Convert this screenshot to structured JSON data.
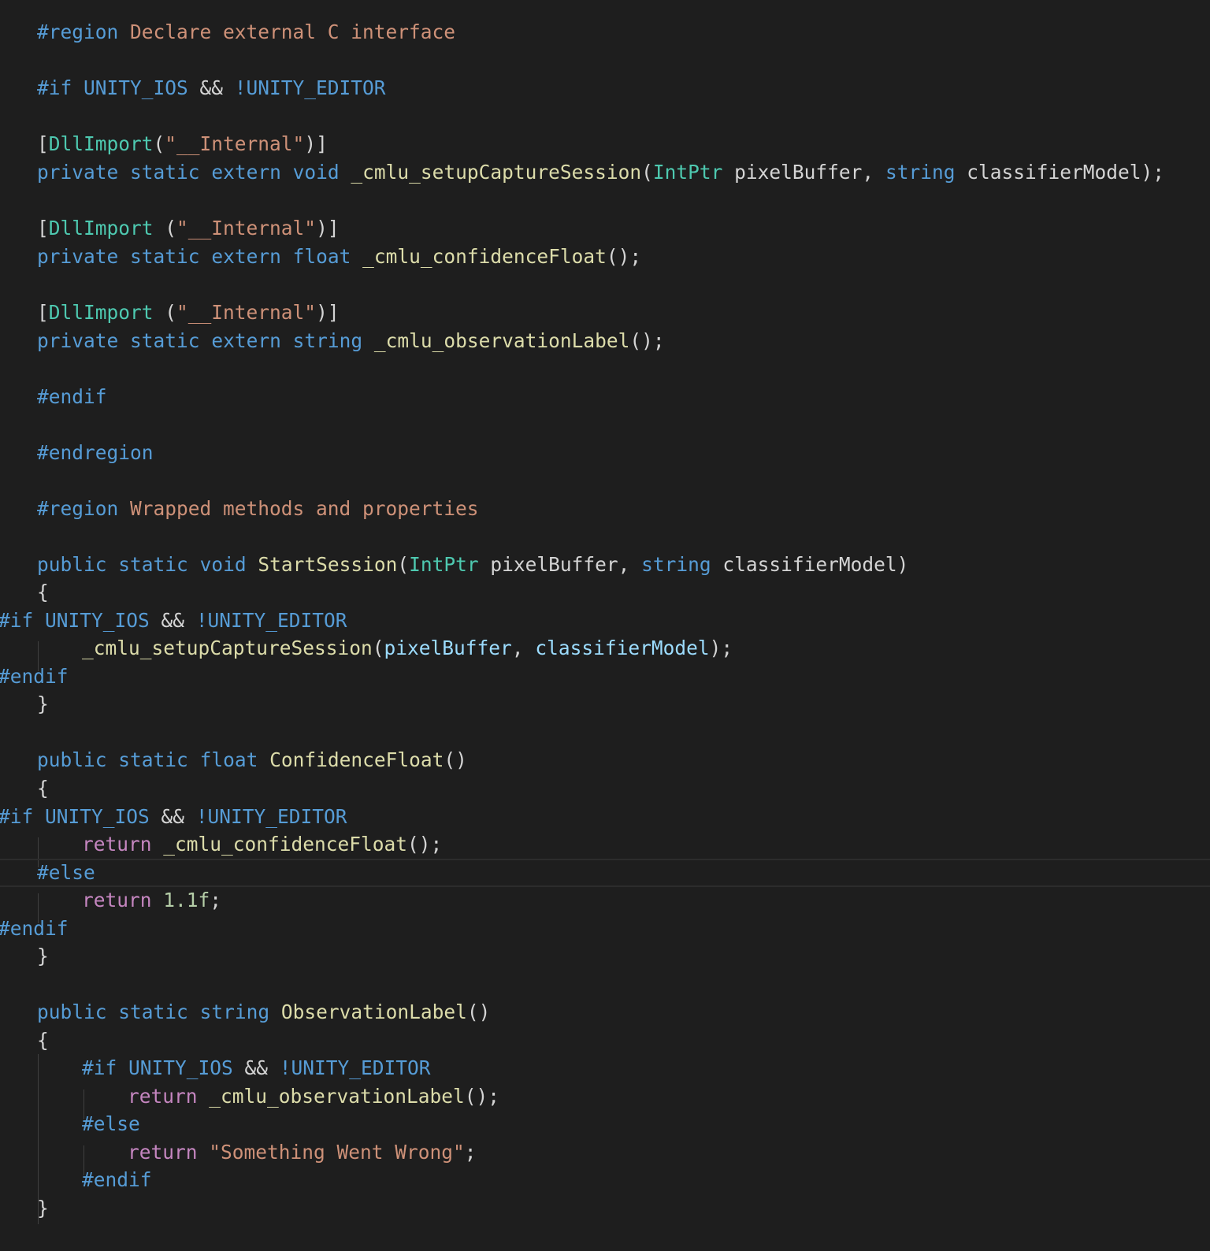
{
  "editor": {
    "theme_colors": {
      "background": "#1e1e1e",
      "keyword": "#569cd6",
      "control": "#c586c0",
      "type": "#4ec9b0",
      "function": "#dcdcaa",
      "variable": "#9cdcfe",
      "string": "#ce9178",
      "number": "#b5cea8",
      "text": "#d4d4d4"
    },
    "lines": [
      {
        "tokens": [
          [
            "pre",
            "#region"
          ],
          [
            "reg",
            " Declare external C interface"
          ]
        ]
      },
      {
        "tokens": [
          [
            "pre",
            "#if UNITY_IOS "
          ],
          [
            "punc",
            "&& "
          ],
          [
            "pre",
            "!UNITY_EDITOR"
          ]
        ]
      },
      {
        "tokens": [
          [
            "punc",
            "["
          ],
          [
            "type",
            "DllImport"
          ],
          [
            "punc",
            "("
          ],
          [
            "str",
            "\"__Internal\""
          ],
          [
            "punc",
            ")]"
          ]
        ]
      },
      {
        "tokens": [
          [
            "kw",
            "private"
          ],
          [
            "punc",
            " "
          ],
          [
            "kw",
            "static"
          ],
          [
            "punc",
            " "
          ],
          [
            "kw",
            "extern"
          ],
          [
            "punc",
            " "
          ],
          [
            "kw",
            "void"
          ],
          [
            "punc",
            " "
          ],
          [
            "fn",
            "_cmlu_setupCaptureSession"
          ],
          [
            "punc",
            "("
          ],
          [
            "type",
            "IntPtr"
          ],
          [
            "id",
            " pixelBuffer, "
          ],
          [
            "kw",
            "string"
          ],
          [
            "id",
            " classifierModel);"
          ]
        ]
      },
      {
        "tokens": [
          [
            "punc",
            "["
          ],
          [
            "type",
            "DllImport"
          ],
          [
            "punc",
            " ("
          ],
          [
            "str",
            "\"__Internal\""
          ],
          [
            "punc",
            ")]"
          ]
        ]
      },
      {
        "tokens": [
          [
            "kw",
            "private"
          ],
          [
            "punc",
            " "
          ],
          [
            "kw",
            "static"
          ],
          [
            "punc",
            " "
          ],
          [
            "kw",
            "extern"
          ],
          [
            "punc",
            " "
          ],
          [
            "kw",
            "float"
          ],
          [
            "punc",
            " "
          ],
          [
            "fn",
            "_cmlu_confidenceFloat"
          ],
          [
            "punc",
            "();"
          ]
        ]
      },
      {
        "tokens": [
          [
            "punc",
            "["
          ],
          [
            "type",
            "DllImport"
          ],
          [
            "punc",
            " ("
          ],
          [
            "str",
            "\"__Internal\""
          ],
          [
            "punc",
            ")]"
          ]
        ]
      },
      {
        "tokens": [
          [
            "kw",
            "private"
          ],
          [
            "punc",
            " "
          ],
          [
            "kw",
            "static"
          ],
          [
            "punc",
            " "
          ],
          [
            "kw",
            "extern"
          ],
          [
            "punc",
            " "
          ],
          [
            "kw",
            "string"
          ],
          [
            "punc",
            " "
          ],
          [
            "fn",
            "_cmlu_observationLabel"
          ],
          [
            "punc",
            "();"
          ]
        ]
      },
      {
        "tokens": [
          [
            "pre",
            "#endif"
          ]
        ]
      },
      {
        "tokens": [
          [
            "pre",
            "#endregion"
          ]
        ]
      },
      {
        "tokens": [
          [
            "pre",
            "#region"
          ],
          [
            "reg",
            " Wrapped methods and properties"
          ]
        ]
      },
      {
        "tokens": [
          [
            "kw",
            "public"
          ],
          [
            "punc",
            " "
          ],
          [
            "kw",
            "static"
          ],
          [
            "punc",
            " "
          ],
          [
            "kw",
            "void"
          ],
          [
            "punc",
            " "
          ],
          [
            "fn",
            "StartSession"
          ],
          [
            "punc",
            "("
          ],
          [
            "type",
            "IntPtr"
          ],
          [
            "id",
            " pixelBuffer, "
          ],
          [
            "kw",
            "string"
          ],
          [
            "id",
            " classifierModel)"
          ]
        ]
      },
      {
        "tokens": [
          [
            "punc",
            "{"
          ]
        ]
      },
      {
        "tokens": [
          [
            "pre",
            "#if UNITY_IOS "
          ],
          [
            "punc",
            "&& "
          ],
          [
            "pre",
            "!UNITY_EDITOR"
          ]
        ]
      },
      {
        "tokens": [
          [
            "fn",
            "_cmlu_setupCaptureSession"
          ],
          [
            "punc",
            "("
          ],
          [
            "var",
            "pixelBuffer"
          ],
          [
            "punc",
            ", "
          ],
          [
            "var",
            "classifierModel"
          ],
          [
            "punc",
            ");"
          ]
        ]
      },
      {
        "tokens": [
          [
            "pre",
            "#endif"
          ]
        ]
      },
      {
        "tokens": [
          [
            "punc",
            "}"
          ]
        ]
      },
      {
        "tokens": [
          [
            "kw",
            "public"
          ],
          [
            "punc",
            " "
          ],
          [
            "kw",
            "static"
          ],
          [
            "punc",
            " "
          ],
          [
            "kw",
            "float"
          ],
          [
            "punc",
            " "
          ],
          [
            "fn",
            "ConfidenceFloat"
          ],
          [
            "punc",
            "()"
          ]
        ]
      },
      {
        "tokens": [
          [
            "punc",
            "{"
          ]
        ]
      },
      {
        "tokens": [
          [
            "pre",
            "#if UNITY_IOS "
          ],
          [
            "punc",
            "&& "
          ],
          [
            "pre",
            "!UNITY_EDITOR"
          ]
        ]
      },
      {
        "tokens": [
          [
            "ctl",
            "return"
          ],
          [
            "punc",
            " "
          ],
          [
            "fn",
            "_cmlu_confidenceFloat"
          ],
          [
            "punc",
            "();"
          ]
        ]
      },
      {
        "tokens": [
          [
            "pre",
            "#else"
          ]
        ]
      },
      {
        "tokens": [
          [
            "ctl",
            "return"
          ],
          [
            "punc",
            " "
          ],
          [
            "num",
            "1.1f"
          ],
          [
            "punc",
            ";"
          ]
        ]
      },
      {
        "tokens": [
          [
            "pre",
            "#endif"
          ]
        ]
      },
      {
        "tokens": [
          [
            "punc",
            "}"
          ]
        ]
      },
      {
        "tokens": [
          [
            "kw",
            "public"
          ],
          [
            "punc",
            " "
          ],
          [
            "kw",
            "static"
          ],
          [
            "punc",
            " "
          ],
          [
            "kw",
            "string"
          ],
          [
            "punc",
            " "
          ],
          [
            "fn",
            "ObservationLabel"
          ],
          [
            "punc",
            "()"
          ]
        ]
      },
      {
        "tokens": [
          [
            "punc",
            "{"
          ]
        ]
      },
      {
        "tokens": [
          [
            "pre",
            "#if UNITY_IOS "
          ],
          [
            "punc",
            "&& "
          ],
          [
            "pre",
            "!UNITY_EDITOR"
          ]
        ]
      },
      {
        "tokens": [
          [
            "ctl",
            "return"
          ],
          [
            "punc",
            " "
          ],
          [
            "fn",
            "_cmlu_observationLabel"
          ],
          [
            "punc",
            "();"
          ]
        ]
      },
      {
        "tokens": [
          [
            "pre",
            "#else"
          ]
        ]
      },
      {
        "tokens": [
          [
            "ctl",
            "return"
          ],
          [
            "punc",
            " "
          ],
          [
            "str",
            "\"Something Went Wrong\""
          ],
          [
            "punc",
            ";"
          ]
        ]
      },
      {
        "tokens": [
          [
            "pre",
            "#endif"
          ]
        ]
      },
      {
        "tokens": [
          [
            "punc",
            "}"
          ]
        ]
      }
    ]
  }
}
